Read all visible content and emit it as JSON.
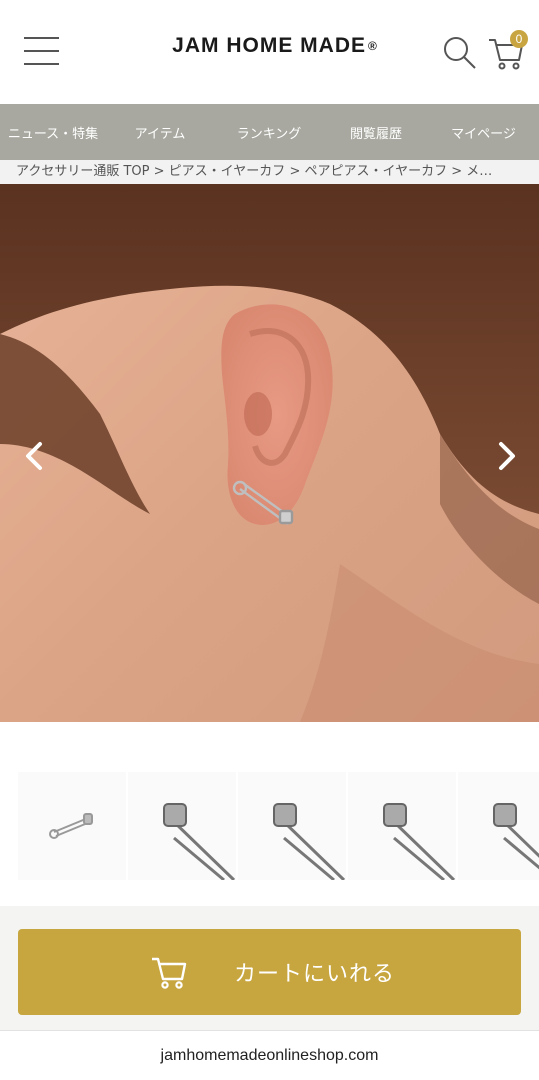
{
  "header": {
    "brand": "JAM HOME MADE",
    "registered_mark": "®",
    "cart_count": "0"
  },
  "nav": {
    "items": [
      {
        "label": "ニュース・特集"
      },
      {
        "label": "アイテム"
      },
      {
        "label": "ランキング"
      },
      {
        "label": "閲覧履歴"
      },
      {
        "label": "マイページ"
      }
    ]
  },
  "breadcrumb": {
    "items": [
      "アクセサリー通販 TOP",
      "ピアス・イヤーカフ",
      "ペアピアス・イヤーカフ",
      "メ…"
    ],
    "separator": ">"
  },
  "gallery": {
    "main_image": "model-ear-safety-pin-earring",
    "prev_icon": "chevron-left-icon",
    "next_icon": "chevron-right-icon",
    "thumbnails": [
      {
        "icon": "safety-pin-earring-thumb"
      },
      {
        "icon": "safety-pin-closeup-thumb"
      },
      {
        "icon": "safety-pin-closeup-thumb"
      },
      {
        "icon": "safety-pin-closeup-thumb"
      },
      {
        "icon": "safety-pin-closeup-thumb"
      }
    ]
  },
  "cart_button": {
    "label": "カートにいれる",
    "icon": "cart-icon"
  },
  "browser": {
    "url": "jamhomemadeonlineshop.com"
  },
  "colors": {
    "accent_gold": "#c7a640",
    "nav_bg": "#a8a8a0"
  }
}
